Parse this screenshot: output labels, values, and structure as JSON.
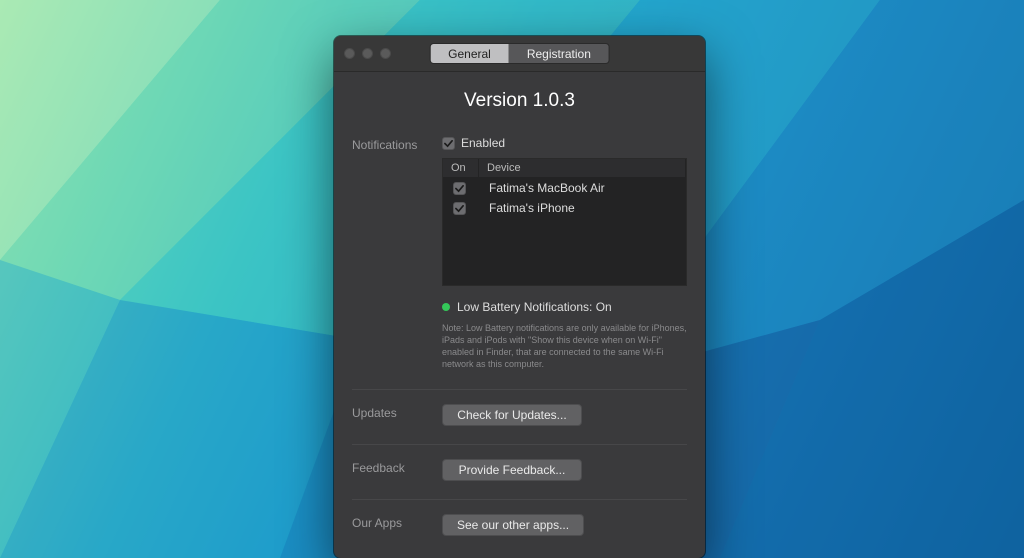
{
  "tabs": {
    "general": "General",
    "registration": "Registration"
  },
  "version_title": "Version 1.0.3",
  "sections": {
    "notifications": {
      "label": "Notifications",
      "enabled_label": "Enabled",
      "enabled": true,
      "table": {
        "col_on": "On",
        "col_device": "Device",
        "rows": [
          {
            "on": true,
            "device": "Fatima's MacBook Air"
          },
          {
            "on": true,
            "device": "Fatima's iPhone"
          }
        ]
      },
      "status_text": "Low Battery Notifications: On",
      "note": "Note: Low Battery notifications are only available for iPhones, iPads and iPods with \"Show this device when on Wi-Fi\" enabled in Finder, that are connected to the same Wi-Fi network as this computer."
    },
    "updates": {
      "label": "Updates",
      "button": "Check for Updates..."
    },
    "feedback": {
      "label": "Feedback",
      "button": "Provide Feedback..."
    },
    "ourapps": {
      "label": "Our Apps",
      "button": "See our other apps..."
    }
  },
  "colors": {
    "status_dot": "#34c759"
  }
}
